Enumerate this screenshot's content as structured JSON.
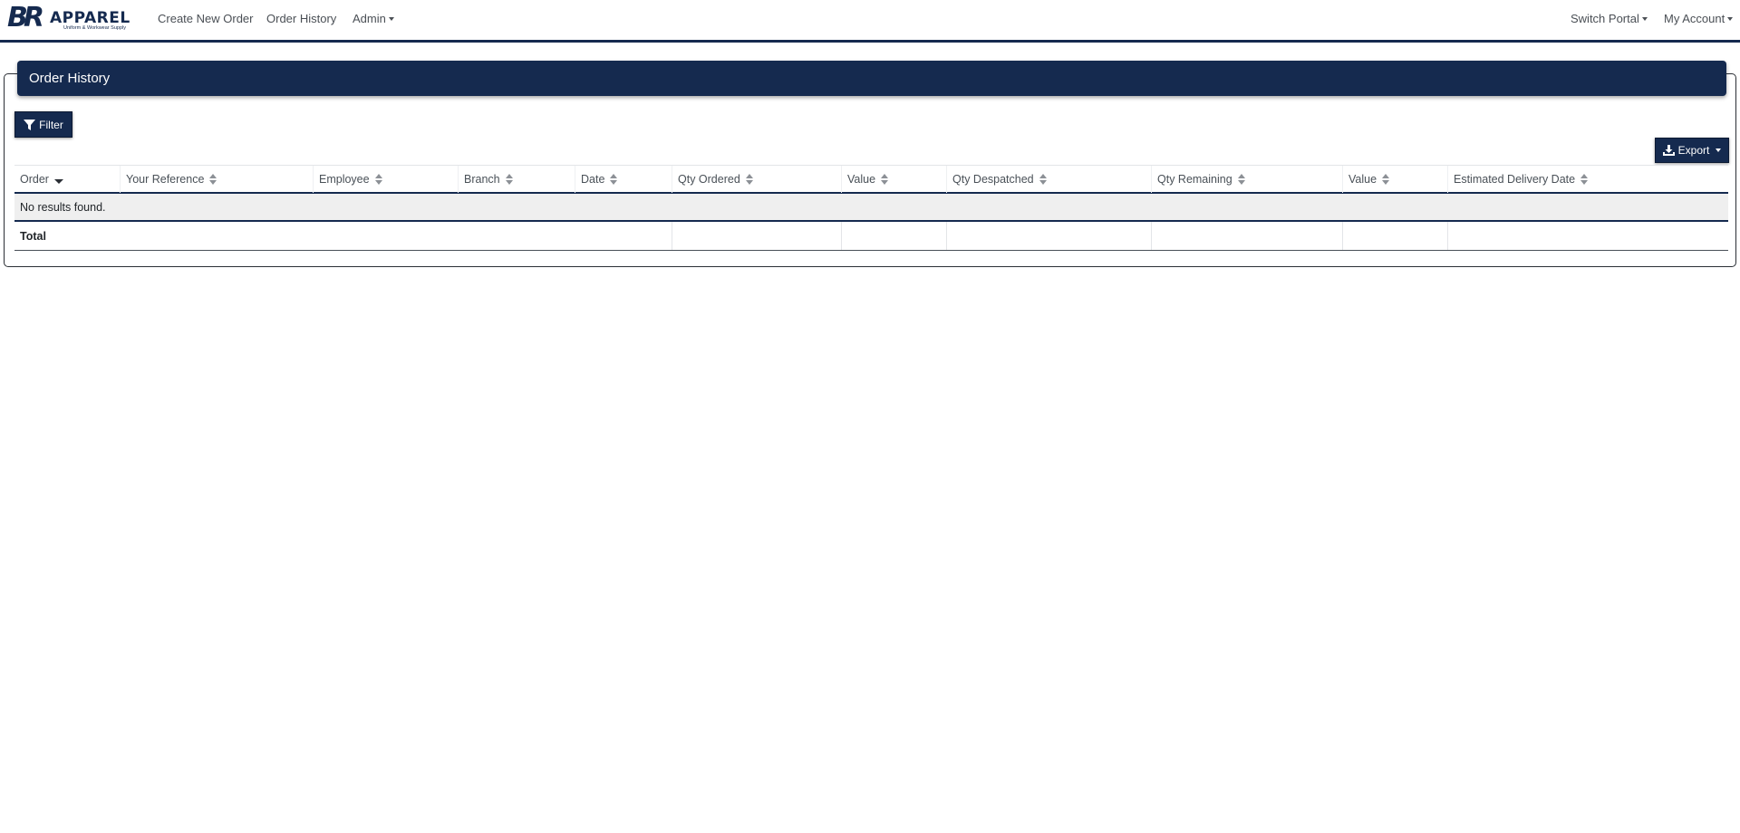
{
  "brand": {
    "logo_letters": "BR",
    "logo_word": "APPAREL",
    "logo_tagline": "Uniform & Workwear Supply"
  },
  "nav": {
    "create_new_order": "Create New Order",
    "order_history": "Order History",
    "admin": "Admin",
    "switch_portal": "Switch Portal",
    "my_account": "My Account"
  },
  "page": {
    "title": "Order History",
    "filter_label": "Filter",
    "export_label": "Export"
  },
  "table": {
    "columns": [
      "Order",
      "Your Reference",
      "Employee",
      "Branch",
      "Date",
      "Qty Ordered",
      "Value",
      "Qty Despatched",
      "Qty Remaining",
      "Value",
      "Estimated Delivery Date"
    ],
    "empty_message": "No results found.",
    "total_label": "Total",
    "sorted_column": "Order",
    "sort_direction": "descending"
  },
  "colors": {
    "brand_navy": "#152a4f",
    "logo_grey": "#7d8794",
    "empty_row_bg": "#efefef"
  },
  "icons": {
    "filter": "filter-funnel-icon",
    "export": "download-icon",
    "sort": "sort-icon",
    "sort_desc": "sort-desc-icon",
    "dropdown": "caret-down-icon"
  }
}
